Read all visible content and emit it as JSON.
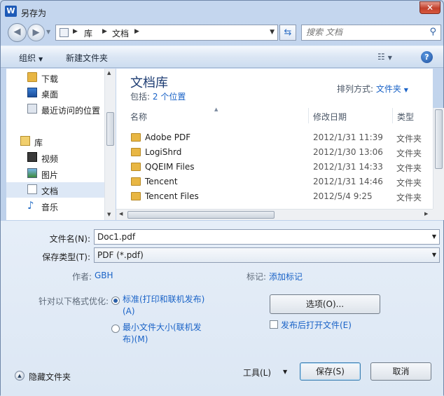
{
  "window": {
    "title": "另存为",
    "app_icon": "W",
    "close": "✕"
  },
  "address": {
    "crumbs": [
      "库",
      "文档"
    ],
    "search_placeholder": "搜索 文档"
  },
  "toolbar": {
    "organize": "组织",
    "new_folder": "新建文件夹"
  },
  "nav": {
    "items": [
      {
        "label": "下载",
        "icon": "download-folder-icon"
      },
      {
        "label": "桌面",
        "icon": "desktop-icon"
      },
      {
        "label": "最近访问的位置",
        "icon": "recent-places-icon"
      },
      {
        "label": "库",
        "icon": "library-icon"
      },
      {
        "label": "视频",
        "icon": "video-icon"
      },
      {
        "label": "图片",
        "icon": "pictures-icon"
      },
      {
        "label": "文档",
        "icon": "documents-icon",
        "selected": true
      },
      {
        "label": "音乐",
        "icon": "music-icon"
      }
    ]
  },
  "library": {
    "title": "文档库",
    "includes_label": "包括:",
    "includes_link": "2 个位置",
    "arrange_label": "排列方式:",
    "arrange_value": "文件夹"
  },
  "columns": {
    "name": "名称",
    "date": "修改日期",
    "type": "类型"
  },
  "files": [
    {
      "name": "Adobe PDF",
      "date": "2012/1/31 11:39",
      "type": "文件夹"
    },
    {
      "name": "LogiShrd",
      "date": "2012/1/30 13:06",
      "type": "文件夹"
    },
    {
      "name": "QQEIM Files",
      "date": "2012/1/31 14:33",
      "type": "文件夹"
    },
    {
      "name": "Tencent",
      "date": "2012/1/31 14:46",
      "type": "文件夹"
    },
    {
      "name": "Tencent Files",
      "date": "2012/5/4 9:25",
      "type": "文件夹"
    }
  ],
  "form": {
    "filename_label": "文件名(N):",
    "filename_value": "Doc1.pdf",
    "filetype_label": "保存类型(T):",
    "filetype_value": "PDF (*.pdf)",
    "author_label": "作者:",
    "author_value": "GBH",
    "tags_label": "标记:",
    "tags_value": "添加标记",
    "optimize_label": "针对以下格式优化:",
    "radio_standard_line1": "标准(打印和联机发布)",
    "radio_standard_line2": "(A)",
    "radio_min_line1": "最小文件大小(联机发",
    "radio_min_line2": "布)(M)",
    "options_button": "选项(O)...",
    "open_after_label": "发布后打开文件(E)",
    "hide_folders": "隐藏文件夹",
    "tools": "工具(L)",
    "save": "保存(S)",
    "cancel": "取消"
  }
}
